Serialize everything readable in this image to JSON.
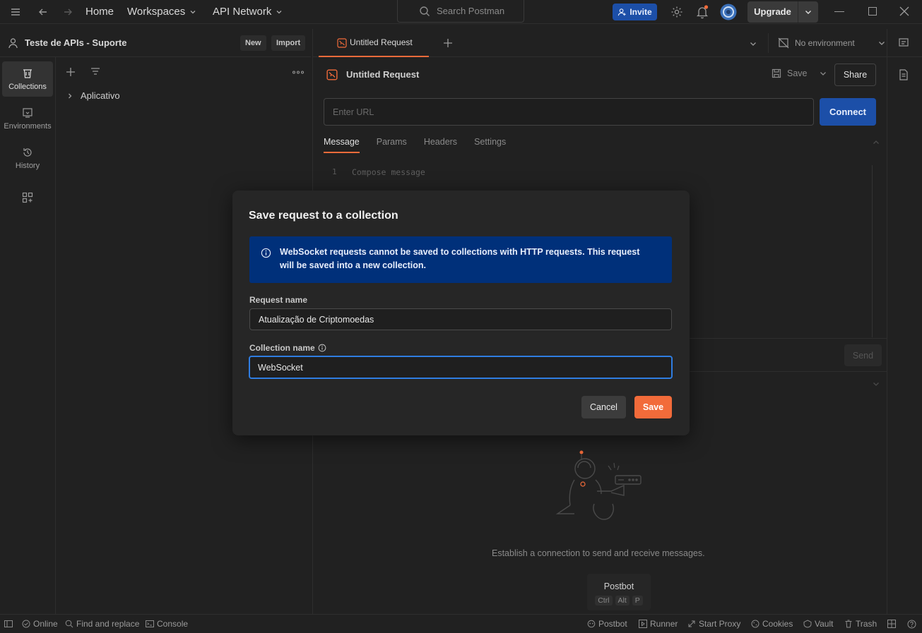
{
  "titlebar": {
    "home": "Home",
    "workspaces": "Workspaces",
    "api_network": "API Network",
    "search_placeholder": "Search Postman",
    "invite": "Invite",
    "upgrade": "Upgrade"
  },
  "workspace": {
    "name": "Teste de APIs - Suporte",
    "new_label": "New",
    "import_label": "Import"
  },
  "rail": {
    "collections": "Collections",
    "environments": "Environments",
    "history": "History"
  },
  "sidebar": {
    "collections": [
      {
        "name": "Aplicativo"
      }
    ]
  },
  "tabs": {
    "active_tab": "Untitled Request",
    "environment": "No environment"
  },
  "request": {
    "title": "Untitled Request",
    "save": "Save",
    "share": "Share",
    "url_placeholder": "Enter URL",
    "connect": "Connect",
    "subtabs": [
      "Message",
      "Params",
      "Headers",
      "Settings"
    ],
    "editor_line": "1",
    "editor_placeholder": "Compose message",
    "send": "Send"
  },
  "response": {
    "empty_text": "Establish a connection to send and receive messages.",
    "postbot_title": "Postbot",
    "postbot_keys": [
      "Ctrl",
      "Alt",
      "P"
    ]
  },
  "dialog": {
    "title": "Save request to a collection",
    "banner": "WebSocket requests cannot be saved to collections with HTTP requests. This request will be saved into a new collection.",
    "request_name_label": "Request name",
    "request_name_value": "Atualização de Criptomoedas",
    "collection_name_label": "Collection name",
    "collection_name_value": "WebSocket",
    "cancel": "Cancel",
    "save": "Save"
  },
  "statusbar": {
    "online": "Online",
    "find_replace": "Find and replace",
    "console": "Console",
    "postbot": "Postbot",
    "runner": "Runner",
    "start_proxy": "Start Proxy",
    "cookies": "Cookies",
    "vault": "Vault",
    "trash": "Trash"
  },
  "colors": {
    "accent_orange": "#f26b3a",
    "primary_blue": "#1c4fa8",
    "banner_blue": "#00307a",
    "focus_blue": "#2f7de1"
  }
}
